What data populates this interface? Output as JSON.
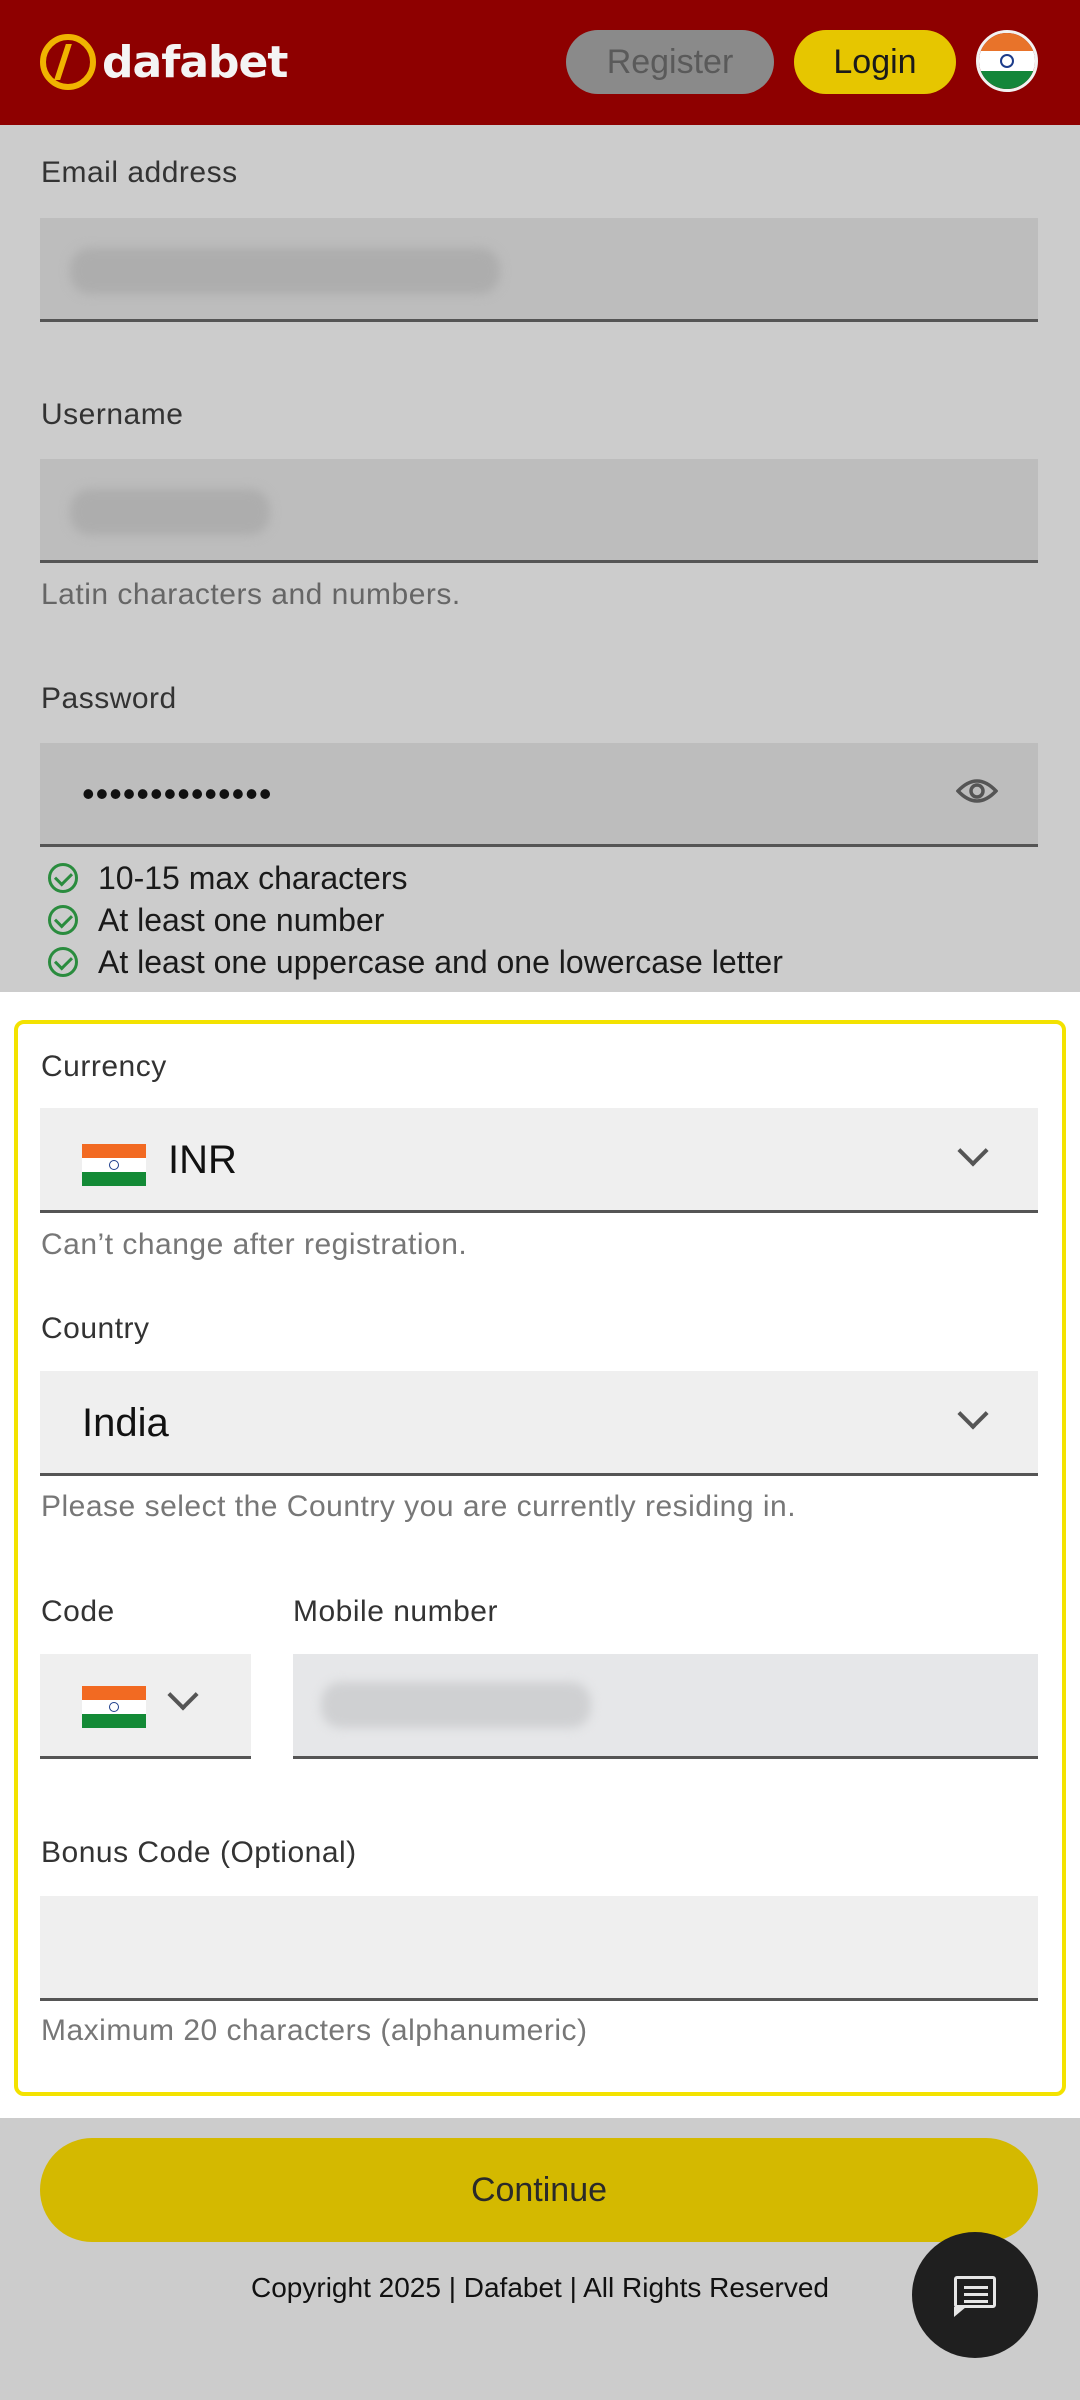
{
  "header": {
    "logo_text": "dafabet",
    "register_label": "Register",
    "login_label": "Login",
    "flag_icon": "india-flag-icon"
  },
  "account": {
    "email_label": "Email address",
    "username_label": "Username",
    "username_hint": "Latin characters and numbers.",
    "password_label": "Password",
    "password_value": "••••••••••••••",
    "password_requirements": [
      "10-15 max characters",
      "At least one number",
      "At least one uppercase and one lowercase letter"
    ]
  },
  "details": {
    "currency_label": "Currency",
    "currency_value": "INR",
    "currency_hint": "Can’t change after registration.",
    "country_label": "Country",
    "country_value": "India",
    "country_hint": "Please select the Country you are currently residing in.",
    "code_label": "Code",
    "mobile_label": "Mobile number",
    "bonus_label": "Bonus Code (Optional)",
    "bonus_value": "",
    "bonus_hint": "Maximum 20 characters (alphanumeric)"
  },
  "footer": {
    "continue_label": "Continue",
    "copyright": "Copyright 2025 | Dafabet | All Rights Reserved",
    "chat_icon": "chat-icon"
  },
  "colors": {
    "header_bg": "#8e0000",
    "login_bg": "#e6c600",
    "continue_bg": "#d4b900",
    "highlight_border": "#f3e200",
    "check_green": "#2a8c3e"
  }
}
